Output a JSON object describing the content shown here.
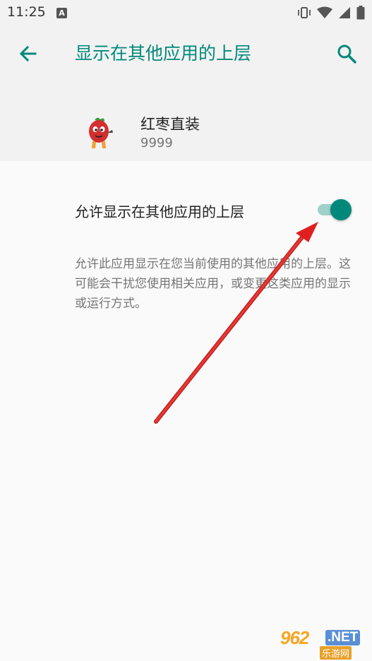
{
  "status_bar": {
    "time": "11:25",
    "notification_icon": "a-letter-icon",
    "icons": [
      "vibrate-icon",
      "wifi-icon",
      "signal-icon",
      "battery-icon"
    ]
  },
  "app_bar": {
    "title": "显示在其他应用的上层",
    "back_icon": "arrow-left-icon",
    "search_icon": "search-icon"
  },
  "app_info": {
    "name": "红枣直装",
    "version": "9999",
    "icon": "red-date-mascot-icon"
  },
  "setting": {
    "label": "允许显示在其他应用的上层",
    "toggle_on": true,
    "description": "允许此应用显示在您当前使用的其他应用的上层。这可能会干扰您使用相关应用，或变更这类应用的显示或运行方式。"
  },
  "watermark": {
    "main": "962",
    "net": ".NET",
    "sub": "乐游网"
  },
  "colors": {
    "accent": "#00897b",
    "toggle_track": "#9fd0c9",
    "header_bg": "#f2f2f2",
    "body_bg": "#fafafa",
    "annotation_arrow": "#e02020"
  }
}
